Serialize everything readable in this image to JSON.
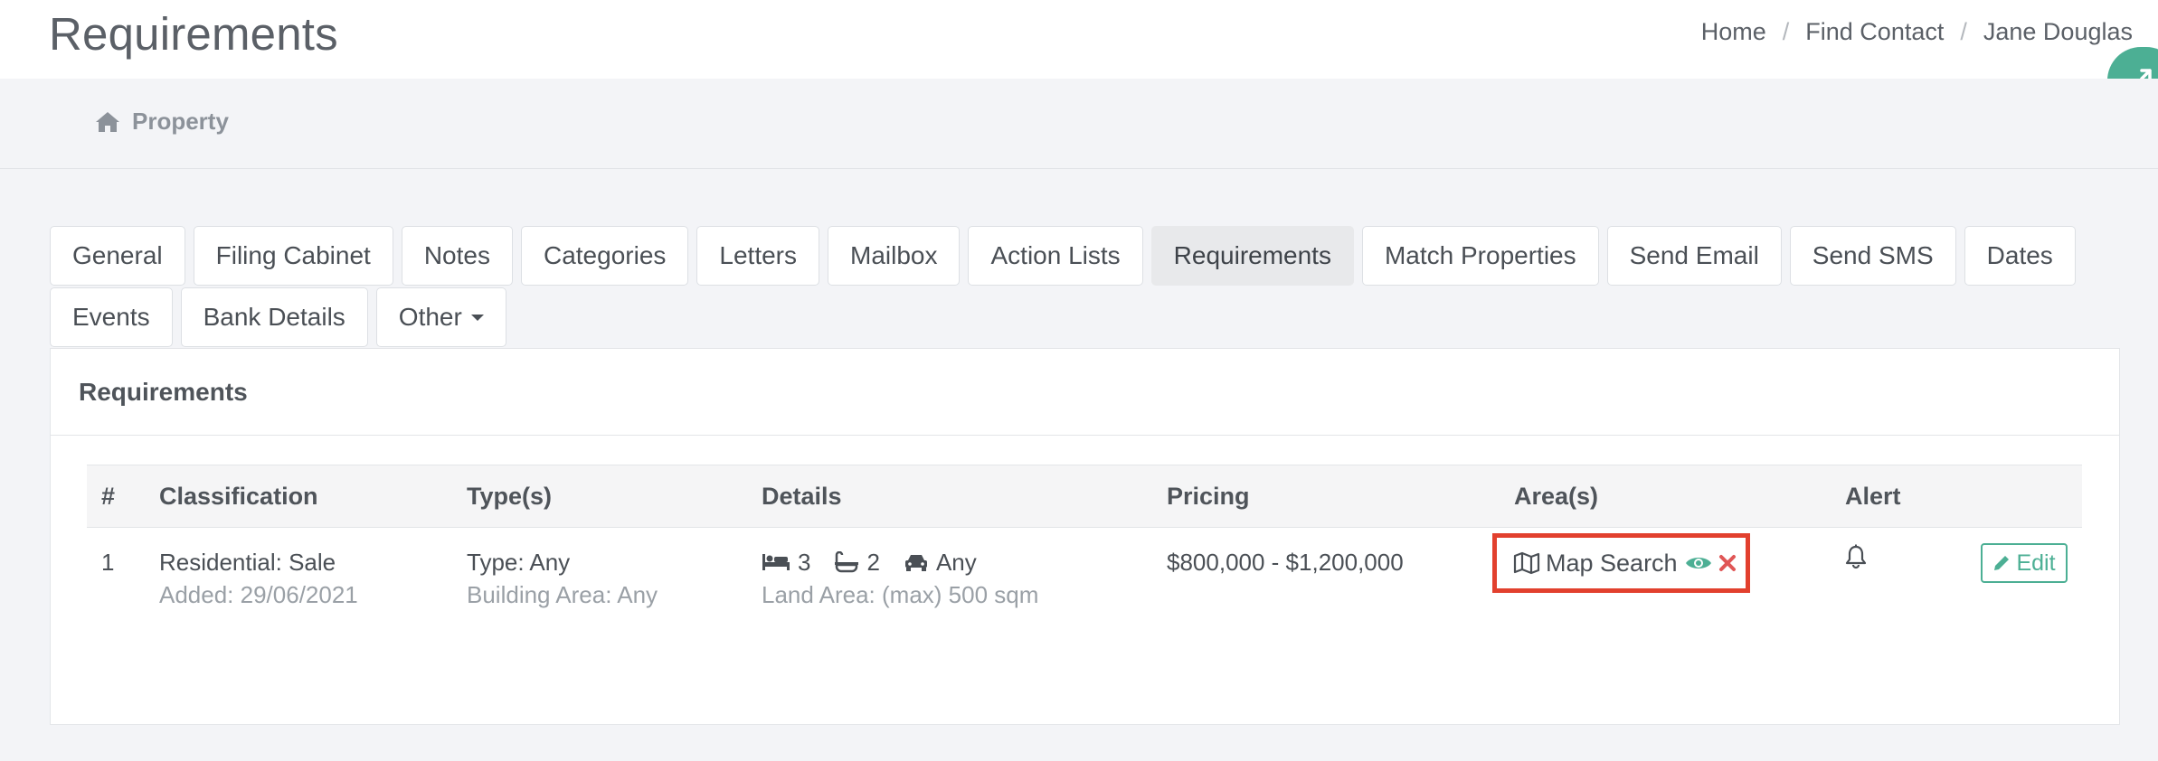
{
  "header": {
    "title": "Requirements",
    "breadcrumb": [
      "Home",
      "Find Contact",
      "Jane Douglas"
    ]
  },
  "subnav": {
    "label": "Property",
    "icon": "home-icon"
  },
  "tabs": {
    "row1": [
      "General",
      "Filing Cabinet",
      "Notes",
      "Categories",
      "Letters",
      "Mailbox",
      "Action Lists",
      "Requirements",
      "Match Properties",
      "Send Email",
      "Send SMS",
      "Dates"
    ],
    "row2": [
      "Events",
      "Bank Details",
      "Other"
    ],
    "active": "Requirements"
  },
  "panel": {
    "title": "Requirements",
    "columns": [
      "#",
      "Classification",
      "Type(s)",
      "Details",
      "Pricing",
      "Area(s)",
      "Alert"
    ],
    "rows": [
      {
        "num": "1",
        "classification": "Residential: Sale",
        "added": "Added: 29/06/2021",
        "type": "Type: Any",
        "building_area": "Building Area: Any",
        "beds": "3",
        "baths": "2",
        "cars": "Any",
        "land_area": "Land Area: (max) 500 sqm",
        "pricing": "$800,000 - $1,200,000",
        "area": "Map Search",
        "edit_label": "Edit"
      }
    ]
  },
  "colors": {
    "accent": "#4caf94",
    "highlight": "#e2402e",
    "remove": "#e05656"
  }
}
